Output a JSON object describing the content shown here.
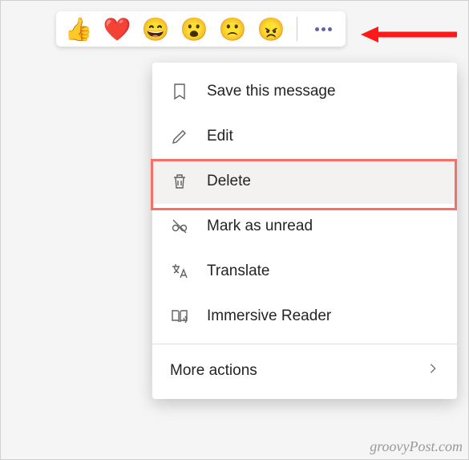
{
  "reactions": [
    {
      "name": "thumbs-up",
      "glyph": "👍"
    },
    {
      "name": "heart",
      "glyph": "❤️"
    },
    {
      "name": "laugh",
      "glyph": "😄"
    },
    {
      "name": "surprised",
      "glyph": "😮"
    },
    {
      "name": "sad",
      "glyph": "🙁"
    },
    {
      "name": "angry",
      "glyph": "😠"
    }
  ],
  "menu": {
    "save": "Save this message",
    "edit": "Edit",
    "delete": "Delete",
    "unread": "Mark as unread",
    "translate": "Translate",
    "immersive": "Immersive Reader",
    "more": "More actions"
  },
  "watermark": "groovyPost.com"
}
